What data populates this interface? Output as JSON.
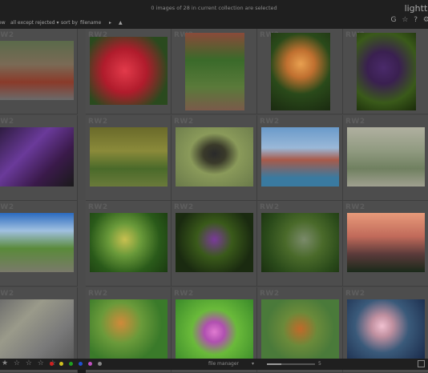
{
  "topbar": {
    "status": "0 images of 28 in current collection are selected",
    "app_title": "lightta"
  },
  "filterbar": {
    "view_label": "ew",
    "rating_filter": "all except rejected",
    "sort_label": "sort by",
    "sort_value": "filename",
    "sort_order_icon": "▲",
    "icons": [
      "G",
      "☆",
      "?",
      "⚙"
    ]
  },
  "grid": {
    "extension_label": "RW2",
    "thumbnails": [
      {
        "bg": "linear-gradient(180deg,#5a6a4a 0%,#7a6a55 40%,#8a3a2a 70%,#6a6a6a 100%)"
      },
      {
        "bg": "radial-gradient(circle at 45% 50%,#e23a4a 0%,#b01c2c 40%,#2a4a1e 80%)"
      },
      {
        "bg": "linear-gradient(180deg,#8a4a3a 0%,#3a6a2a 35%,#5a7a3a 70%,#7a5a4a 100%)"
      },
      {
        "bg": "radial-gradient(circle at 50% 40%,#e8a050 0%,#c07030 25%,#2a4a1a 55%,#1a2a10 100%)"
      },
      {
        "bg": "radial-gradient(circle at 45% 45%,#4a2a6a 0%,#3a2050 30%,#3a5a1a 65%,#1a2a0a 100%)"
      },
      {
        "bg": "linear-gradient(135deg,#2a1a3a 0%,#6a3a9a 40%,#3a1a4a 70%,#1a1a1a 100%)"
      },
      {
        "bg": "linear-gradient(180deg,#6a6a2a 0%,#8a8a3a 40%,#4a6a2a 70%,#6a7a3a 100%)"
      },
      {
        "bg": "radial-gradient(ellipse at 50% 45%,#2a2a2a 0%,#3a3a2a 20%,#8a9a5a 45%,#6a7a4a 100%)"
      },
      {
        "bg": "linear-gradient(180deg,#6a9aca 0%,#9ab8d8 35%,#a85a4a 55%,#3a7aa0 85%)"
      },
      {
        "bg": "linear-gradient(180deg,#b0b0a0 0%,#909a80 40%,#708060 70%,#a0a090 100%)"
      },
      {
        "bg": "linear-gradient(180deg,#2a6ac0 0%,#a0c0e0 30%,#5a8a3a 60%,#7a7a6a 100%)"
      },
      {
        "bg": "radial-gradient(circle at 45% 45%,#c8c050 0%,#6a9a3a 30%,#2a5a1a 65%,#1a3a10 100%)"
      },
      {
        "bg": "radial-gradient(circle at 50% 45%,#7a3a9a 0%,#3a5a1a 35%,#1a2a10 75%)"
      },
      {
        "bg": "radial-gradient(circle at 55% 45%,#7a8a6a 0%,#4a6a2a 35%,#2a4a1a 70%,#1a3010 100%)"
      },
      {
        "bg": "linear-gradient(180deg,#e89a7a 0%,#c06a5a 40%,#5a3a3a 70%,#1a2a1a 100%)"
      },
      {
        "bg": "linear-gradient(135deg,#6a6a6a 0%,#9a9a8a 35%,#7a7a7a 70%,#5a5a5a 100%)"
      },
      {
        "bg": "radial-gradient(circle at 40% 40%,#d08a3a 0%,#6a9a3a 35%,#3a7a2a 70%)"
      },
      {
        "bg": "radial-gradient(circle at 50% 55%,#e07ad0 0%,#b050b0 20%,#6aba3a 45%,#3a8a2a 100%)"
      },
      {
        "bg": "radial-gradient(circle at 50% 50%,#c06a2a 0%,#6a8a3a 35%,#4a7a3a 70%)"
      },
      {
        "bg": "radial-gradient(circle at 45% 45%,#f0c0d0 0%,#c090a0 20%,#3a5a7a 50%,#1a2a4a 100%)"
      }
    ]
  },
  "bottombar": {
    "stars": "★ ☆ ☆ ☆ ☆",
    "color_labels": [
      "#d02020",
      "#d0c020",
      "#20a020",
      "#2050d0",
      "#c050c0",
      "#888888"
    ],
    "view_mode": "file manager",
    "zoom_value": "5",
    "zoom_fraction": 0.3
  }
}
